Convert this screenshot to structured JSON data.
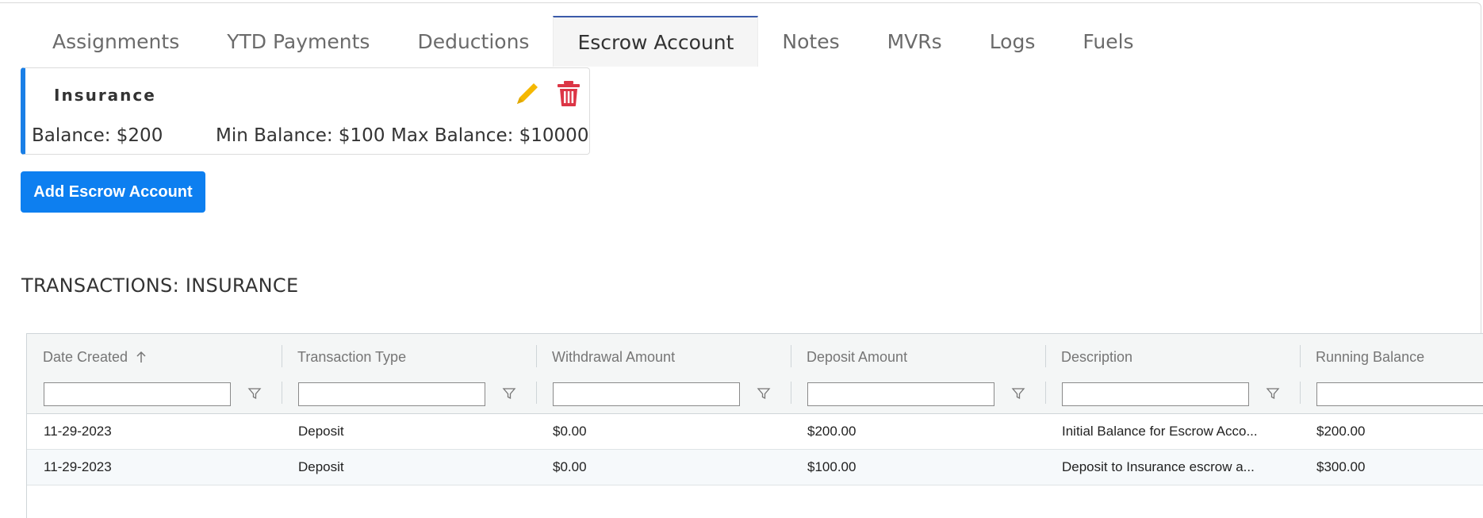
{
  "tabs": [
    {
      "label": "Assignments",
      "active": false
    },
    {
      "label": "YTD Payments",
      "active": false
    },
    {
      "label": "Deductions",
      "active": false
    },
    {
      "label": "Escrow Account",
      "active": true
    },
    {
      "label": "Notes",
      "active": false
    },
    {
      "label": "MVRs",
      "active": false
    },
    {
      "label": "Logs",
      "active": false
    },
    {
      "label": "Fuels",
      "active": false
    }
  ],
  "escrow_card": {
    "title": "Insurance",
    "balance": "Balance: $200",
    "min_balance": "Min Balance: $100",
    "max_balance": "Max Balance: $10000",
    "edit_icon": "pencil-icon",
    "delete_icon": "trash-icon",
    "accent_color": "#1a7fe6"
  },
  "add_button_label": "Add Escrow Account",
  "section_title": "TRANSACTIONS: INSURANCE",
  "grid": {
    "columns": [
      {
        "label": "Date Created",
        "sorted": "ascending"
      },
      {
        "label": "Transaction Type"
      },
      {
        "label": "Withdrawal Amount"
      },
      {
        "label": "Deposit Amount"
      },
      {
        "label": "Description"
      },
      {
        "label": "Running Balance"
      }
    ],
    "rows": [
      [
        "11-29-2023",
        "Deposit",
        "$0.00",
        "$200.00",
        "Initial Balance for Escrow Acco...",
        "$200.00"
      ],
      [
        "11-29-2023",
        "Deposit",
        "$0.00",
        "$100.00",
        "Deposit to Insurance escrow a...",
        "$300.00"
      ]
    ]
  },
  "colors": {
    "primary_button": "#0d7ff0",
    "edit_icon": "#f5b800",
    "delete_icon": "#dc3545",
    "active_tab_border": "#3b5ba9"
  }
}
